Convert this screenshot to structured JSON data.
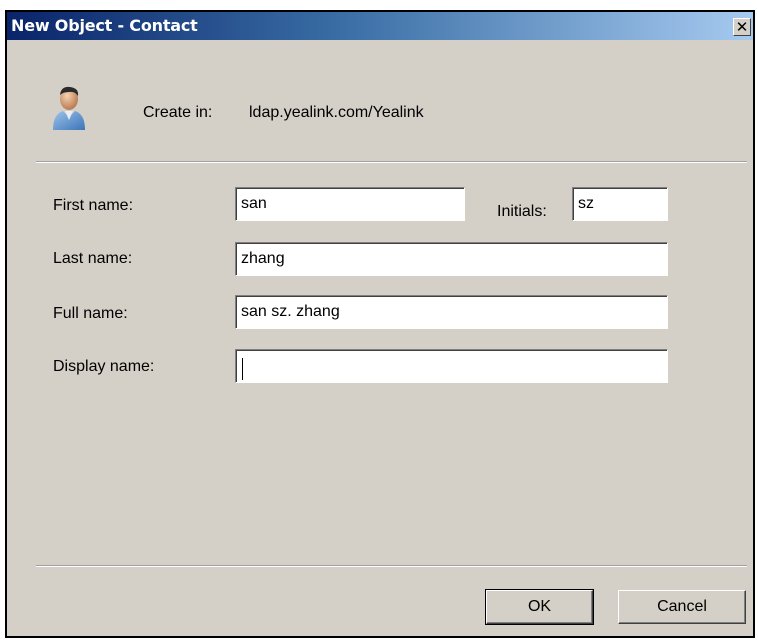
{
  "window": {
    "title": "New Object - Contact",
    "close_glyph": "✕"
  },
  "header": {
    "icon": "contact-user-icon",
    "create_in_label": "Create in:",
    "create_in_path": "ldap.yealink.com/Yealink"
  },
  "form": {
    "first_name_label": "First name:",
    "first_name_value": "san",
    "initials_label": "Initials:",
    "initials_value": "sz",
    "last_name_label": "Last name:",
    "last_name_value": "zhang",
    "full_name_label": "Full name:",
    "full_name_value": "san sz. zhang",
    "display_name_label": "Display name:",
    "display_name_value": ""
  },
  "buttons": {
    "ok_label": "OK",
    "cancel_label": "Cancel"
  },
  "colors": {
    "titlebar_start": "#0a246a",
    "titlebar_end": "#a6caf0",
    "dialog_face": "#d4d0c8"
  }
}
